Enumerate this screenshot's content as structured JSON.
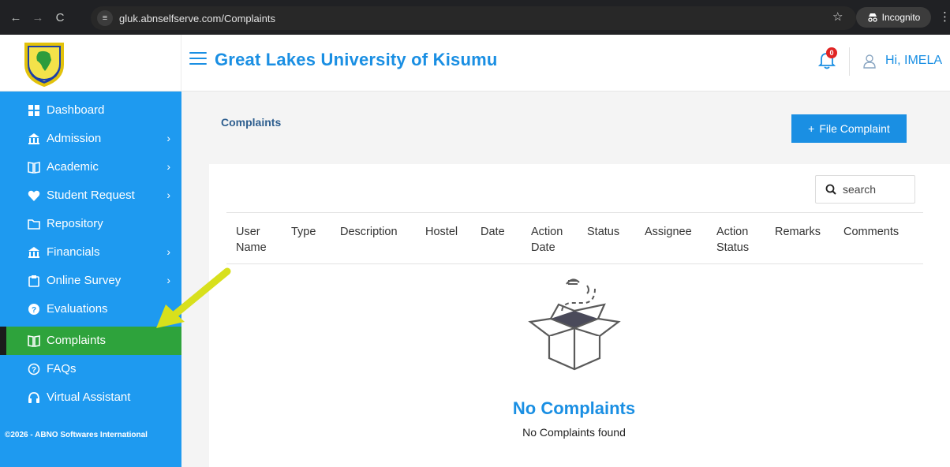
{
  "browser": {
    "url": "gluk.abnselfserve.com/Complaints",
    "mode_label": "Incognito"
  },
  "header": {
    "title": "Great Lakes University of Kisumu",
    "notification_count": "0",
    "greeting": "Hi, IMELA"
  },
  "sidebar": {
    "items": [
      {
        "label": "Dashboard",
        "icon": "dashboard-icon",
        "has_submenu": false
      },
      {
        "label": "Admission",
        "icon": "bank-icon",
        "has_submenu": true
      },
      {
        "label": "Academic",
        "icon": "book-icon",
        "has_submenu": true
      },
      {
        "label": "Student Request",
        "icon": "heart-handshake-icon",
        "has_submenu": true
      },
      {
        "label": "Repository",
        "icon": "folder-icon",
        "has_submenu": false
      },
      {
        "label": "Financials",
        "icon": "bank-icon",
        "has_submenu": true
      },
      {
        "label": "Online Survey",
        "icon": "clipboard-icon",
        "has_submenu": true
      },
      {
        "label": "Evaluations",
        "icon": "help-circle-icon",
        "has_submenu": false
      },
      {
        "label": "Complaints",
        "icon": "book-icon",
        "has_submenu": false,
        "active": true
      },
      {
        "label": "FAQs",
        "icon": "question-circle-icon",
        "has_submenu": false
      },
      {
        "label": "Virtual Assistant",
        "icon": "headset-icon",
        "has_submenu": false
      }
    ],
    "copyright": "©2026 - ABNO Softwares International"
  },
  "main": {
    "page_title": "Complaints",
    "file_complaint_label": "File Complaint",
    "search_placeholder": "search",
    "columns": [
      "User Name",
      "Type",
      "Description",
      "Hostel",
      "Date",
      "Action Date",
      "Status",
      "Assignee",
      "Action Status",
      "Remarks",
      "Comments"
    ],
    "empty_title": "No Complaints",
    "empty_subtitle": "No Complaints found"
  },
  "colors": {
    "primary": "#1a8fe3",
    "sidebar": "#1e9af0",
    "active_item": "#2ea33c",
    "annotation_arrow": "#d8e01c"
  }
}
